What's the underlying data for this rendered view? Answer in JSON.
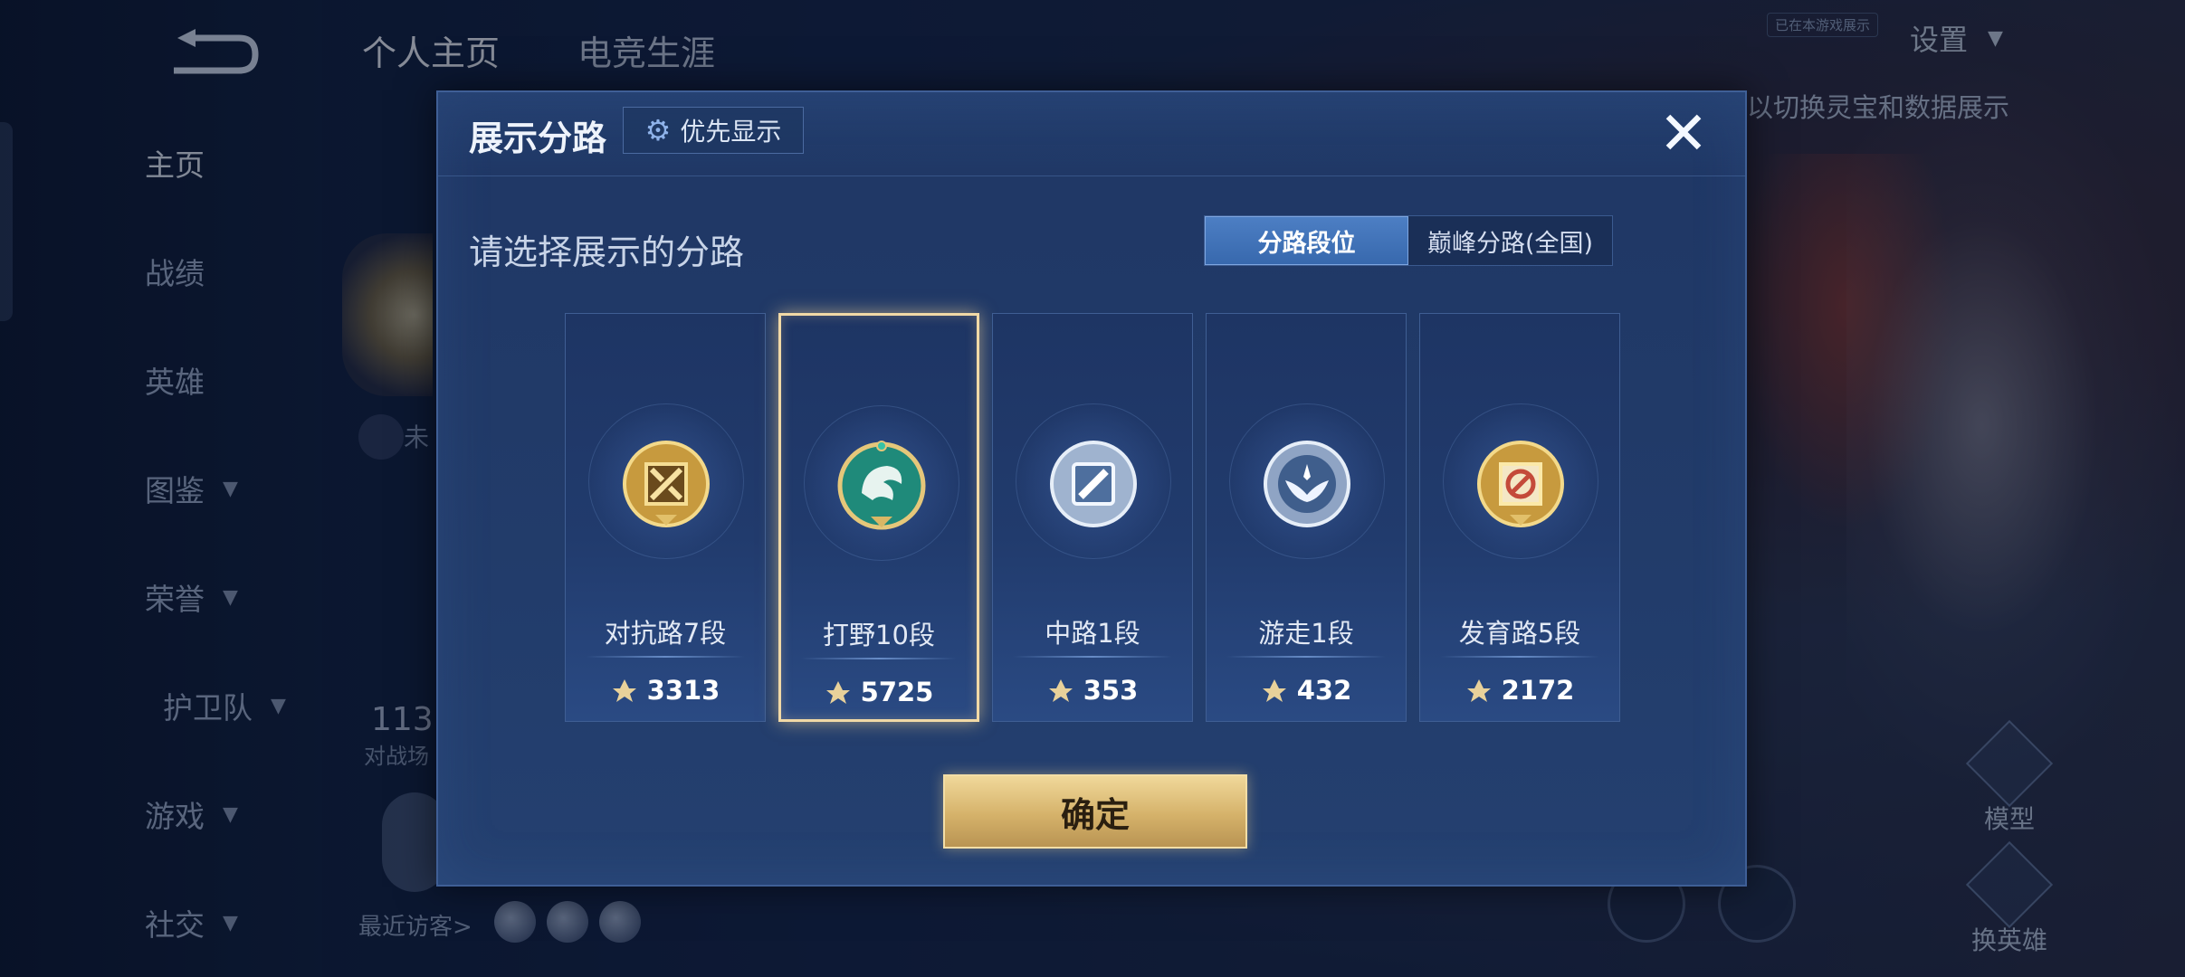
{
  "nav": {
    "items": [
      {
        "label": "主页",
        "active": true,
        "chevron": false
      },
      {
        "label": "战绩",
        "active": false,
        "chevron": false
      },
      {
        "label": "英雄",
        "active": false,
        "chevron": false
      },
      {
        "label": "图鉴",
        "active": false,
        "chevron": true
      },
      {
        "label": "荣誉",
        "active": false,
        "chevron": true
      },
      {
        "label": "护卫队",
        "active": false,
        "chevron": true
      },
      {
        "label": "游戏",
        "active": false,
        "chevron": true
      },
      {
        "label": "社交",
        "active": false,
        "chevron": true
      }
    ]
  },
  "header": {
    "tabs": [
      {
        "label": "个人主页",
        "active": true
      },
      {
        "label": "电竞生涯",
        "active": false
      }
    ],
    "settings_label": "设置",
    "mini_tag": "已在本游戏展示",
    "hint": "以切换灵宝和数据展示"
  },
  "background": {
    "frag_text": "未",
    "stat_number": "113",
    "stat_label": "对战场",
    "visitors_label": "最近访客>",
    "model_label": "模型",
    "switch_hero_label": "换英雄"
  },
  "modal": {
    "title": "展示分路",
    "priority_label": "优先显示",
    "close_symbol": "✕",
    "subtitle": "请选择展示的分路",
    "toggle": [
      "分路段位",
      "巅峰分路(全国)"
    ],
    "toggle_selected": 0,
    "lanes": [
      {
        "name": "对抗路7段",
        "score": "3313",
        "icon": "clash-lane-emblem",
        "tier": "gold"
      },
      {
        "name": "打野10段",
        "score": "5725",
        "icon": "jungle-dragon-emblem",
        "tier": "jade",
        "selected": true
      },
      {
        "name": "中路1段",
        "score": "353",
        "icon": "mid-lane-emblem",
        "tier": "silver"
      },
      {
        "name": "游走1段",
        "score": "432",
        "icon": "roam-wings-emblem",
        "tier": "silver"
      },
      {
        "name": "发育路5段",
        "score": "2172",
        "icon": "farm-lane-emblem",
        "tier": "gold"
      }
    ],
    "confirm_label": "确定"
  },
  "colors": {
    "accent_gold": "#d5b26a",
    "selected_border": "#f1d9a6",
    "toggle_active": "#3768ad"
  }
}
